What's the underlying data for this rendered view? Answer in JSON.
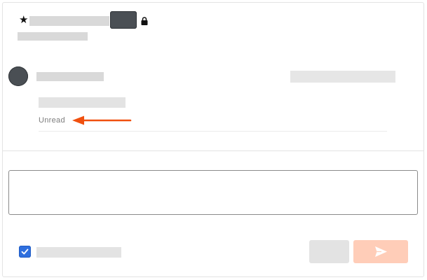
{
  "message": {
    "status_label": "Unread"
  },
  "colors": {
    "accent_arrow": "#f0500f",
    "checkbox_blue": "#2f6fde",
    "send_button": "#ffcdb8",
    "avatar_dark": "#4a4f54"
  },
  "icons": {
    "star": "star-icon",
    "lock": "lock-icon",
    "check": "checkmark-icon",
    "send": "paper-plane-send-icon",
    "arrow": "arrow-left-icon"
  },
  "composer": {
    "checkbox_checked": true
  }
}
